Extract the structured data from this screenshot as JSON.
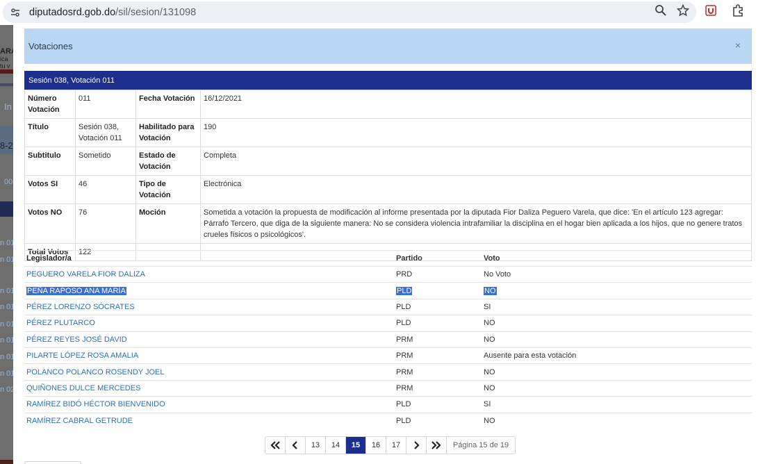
{
  "browser": {
    "url_host": "diputadosrd.gob.do",
    "url_path": "/sil/sesion/131098"
  },
  "backdrop": {
    "items": [
      "ARA",
      "ica",
      "tu v",
      "In",
      "8-2",
      "00",
      "n 01",
      "n 01",
      "n 01",
      "n 01",
      "n 01",
      "n 01",
      "n 01",
      "n 01",
      "n 02"
    ]
  },
  "modal": {
    "title": "Votaciones",
    "close_label": "×",
    "section_title": "Sesión 038, Votación 011",
    "info": {
      "numero_label": "Número Votación",
      "numero_value": "011",
      "fecha_label": "Fecha Votación",
      "fecha_value": "16/12/2021",
      "titulo_label": "Título",
      "titulo_value": "Sesión 038, Votación 011",
      "habilitado_label": "Habilitado para Votación",
      "habilitado_value": "190",
      "subtitulo_label": "Subtitulo",
      "subtitulo_value": "Sometido",
      "estado_label": "Estado de Votación",
      "estado_value": "Completa",
      "votos_si_label": "Votos SI",
      "votos_si_value": "46",
      "tipo_label": "Tipo de Votación",
      "tipo_value": "Electrónica",
      "votos_no_label": "Votos NO",
      "votos_no_value": "76",
      "mocion_label": "Moción",
      "mocion_value": "Sometida a votación la propuesta de modificación al informe presentada por la diputada Fior Daliza Peguero Varela, que dice: 'En el artículo 123 agregar: Párrafo Tercero, que diga de la siguiente manera: No se considera violencia intrafamiliar la disciplina en el hogar bien aplicada a los hijos, que no genere tratos crueles físicos o psicológicos'.",
      "total_label": "Total Votos",
      "total_value": "122"
    },
    "votes": {
      "headers": [
        "Legislador/a",
        "Partido",
        "Voto"
      ],
      "rows": [
        {
          "name": "PEGUERO VARELA FIOR DALIZA",
          "party": "PRD",
          "vote": "No Voto"
        },
        {
          "name": "PEÑA RAPOSO ANA MARÍA",
          "party": "PLD",
          "vote": "NO"
        },
        {
          "name": "PÉREZ LORENZO SÓCRATES",
          "party": "PLD",
          "vote": "SI"
        },
        {
          "name": "PÉREZ PLUTARCO",
          "party": "PLD",
          "vote": "NO"
        },
        {
          "name": "PÉREZ REYES JOSÉ DAVID",
          "party": "PRM",
          "vote": "NO"
        },
        {
          "name": "PILARTE LÓPEZ ROSA AMALIA",
          "party": "PRM",
          "vote": "Ausente para esta votación"
        },
        {
          "name": "POLANCO POLANCO ROSENDY JOEL",
          "party": "PRM",
          "vote": "NO"
        },
        {
          "name": "QUIÑONES DULCE MERCEDES",
          "party": "PRM",
          "vote": "NO"
        },
        {
          "name": "RAMÍREZ BIDÓ HÉCTOR BIENVENIDO",
          "party": "PLD",
          "vote": "SI"
        },
        {
          "name": "RAMÍREZ CABRAL GETRUDE",
          "party": "PLD",
          "vote": "NO"
        }
      ]
    },
    "pagination": {
      "pages": [
        "13",
        "14",
        "15",
        "16",
        "17"
      ],
      "current": "15",
      "info": "Página 15 de 19"
    }
  },
  "colors": {
    "header_bar": "#1c2f8e",
    "modal_header": "#b9d6f3",
    "link": "#2e6fb7",
    "selection": "#3a6fd1"
  }
}
